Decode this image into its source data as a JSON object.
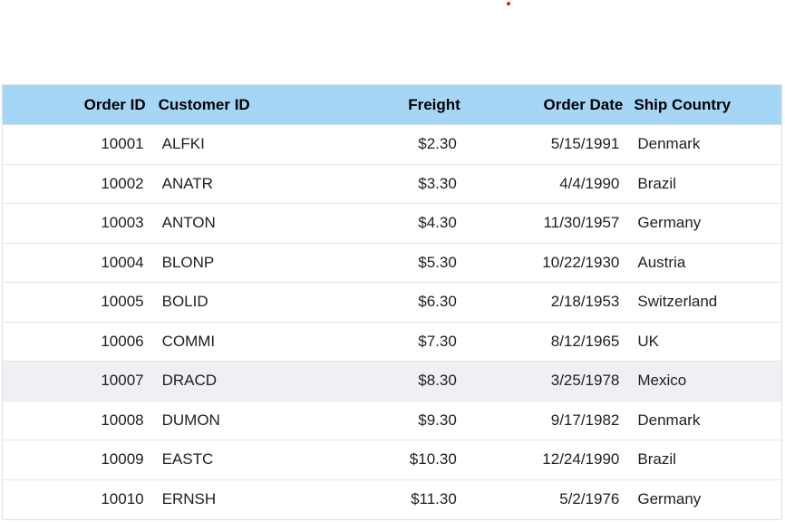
{
  "colors": {
    "header_bg": "#a6d6f5",
    "hover_row_bg": "#eef0f4",
    "indicator_dot": "#ee1111"
  },
  "grid": {
    "columns": [
      "Order ID",
      "Customer ID",
      "Freight",
      "Order Date",
      "Ship Country"
    ],
    "hovered_row_index": 6,
    "rows": [
      [
        "10001",
        "ALFKI",
        "$2.30",
        "5/15/1991",
        "Denmark"
      ],
      [
        "10002",
        "ANATR",
        "$3.30",
        "4/4/1990",
        "Brazil"
      ],
      [
        "10003",
        "ANTON",
        "$4.30",
        "11/30/1957",
        "Germany"
      ],
      [
        "10004",
        "BLONP",
        "$5.30",
        "10/22/1930",
        "Austria"
      ],
      [
        "10005",
        "BOLID",
        "$6.30",
        "2/18/1953",
        "Switzerland"
      ],
      [
        "10006",
        "COMMI",
        "$7.30",
        "8/12/1965",
        "UK"
      ],
      [
        "10007",
        "DRACD",
        "$8.30",
        "3/25/1978",
        "Mexico"
      ],
      [
        "10008",
        "DUMON",
        "$9.30",
        "9/17/1982",
        "Denmark"
      ],
      [
        "10009",
        "EASTC",
        "$10.30",
        "12/24/1990",
        "Brazil"
      ],
      [
        "10010",
        "ERNSH",
        "$11.30",
        "5/2/1976",
        "Germany"
      ]
    ]
  }
}
